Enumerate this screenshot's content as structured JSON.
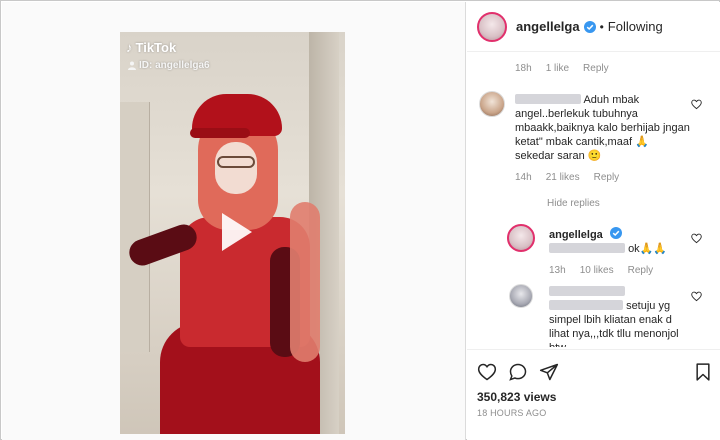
{
  "media": {
    "tiktok_brand": "TikTok",
    "tiktok_id": "ID: angellelga6"
  },
  "header": {
    "username": "angellelga",
    "separator": "•",
    "follow_status": "Following"
  },
  "comments": {
    "first_meta": {
      "time": "18h",
      "likes": "1 like",
      "reply": "Reply"
    },
    "comment1": {
      "text_line1": "Aduh mbak",
      "text_rest": "angel..berlekuk tubuhnya mbaakk,baiknya kalo berhijab jngan ketat\" mbak cantik,maaf 🙏 sekedar saran 🙂",
      "time": "14h",
      "likes": "21 likes",
      "reply": "Reply"
    },
    "hide_replies": "Hide replies",
    "reply1": {
      "username": "angellelga",
      "text": "ok🙏🙏",
      "time": "13h",
      "likes": "10 likes",
      "reply": "Reply"
    },
    "reply2": {
      "text_line1": "setuju yg",
      "text_rest": "simpel lbih kliatan enak d lihat nya,,,tdk tllu menonjol btw"
    }
  },
  "footer": {
    "views": "350,823 views",
    "timestamp": "18 HOURS AGO"
  },
  "colors": {
    "verified": "#3897f0",
    "text": "#262626",
    "muted": "#8e8e8e",
    "story_ring": "#e1306c"
  }
}
